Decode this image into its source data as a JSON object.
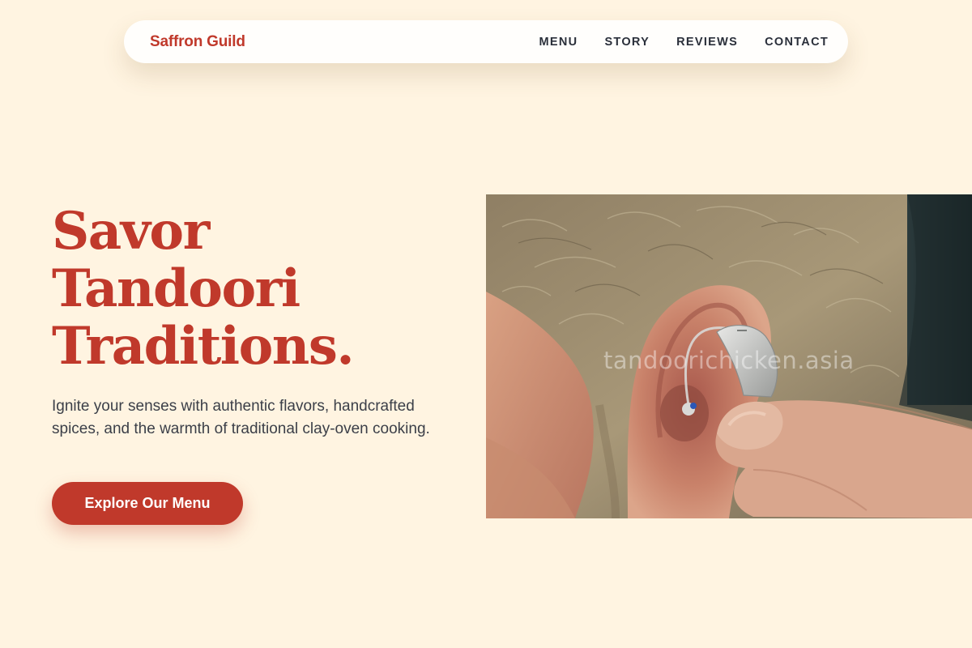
{
  "nav": {
    "brand": "Saffron Guild",
    "links": [
      "MENU",
      "STORY",
      "REVIEWS",
      "CONTACT"
    ]
  },
  "hero": {
    "headline_lines": [
      "Savor",
      "Tandoori",
      "Traditions."
    ],
    "tagline": "Ignite your senses with authentic flavors, handcrafted spices, and the warmth of traditional clay-oven cooking.",
    "cta_label": "Explore Our Menu",
    "image": {
      "subject": "close-up photo of a hand fitting a hearing aid behind an ear",
      "watermark": "tandoorichicken.asia"
    }
  },
  "colors": {
    "background": "#fff4e1",
    "accent": "#c0392b",
    "nav_background": "#fffefc",
    "body_text": "#3b3f48"
  }
}
